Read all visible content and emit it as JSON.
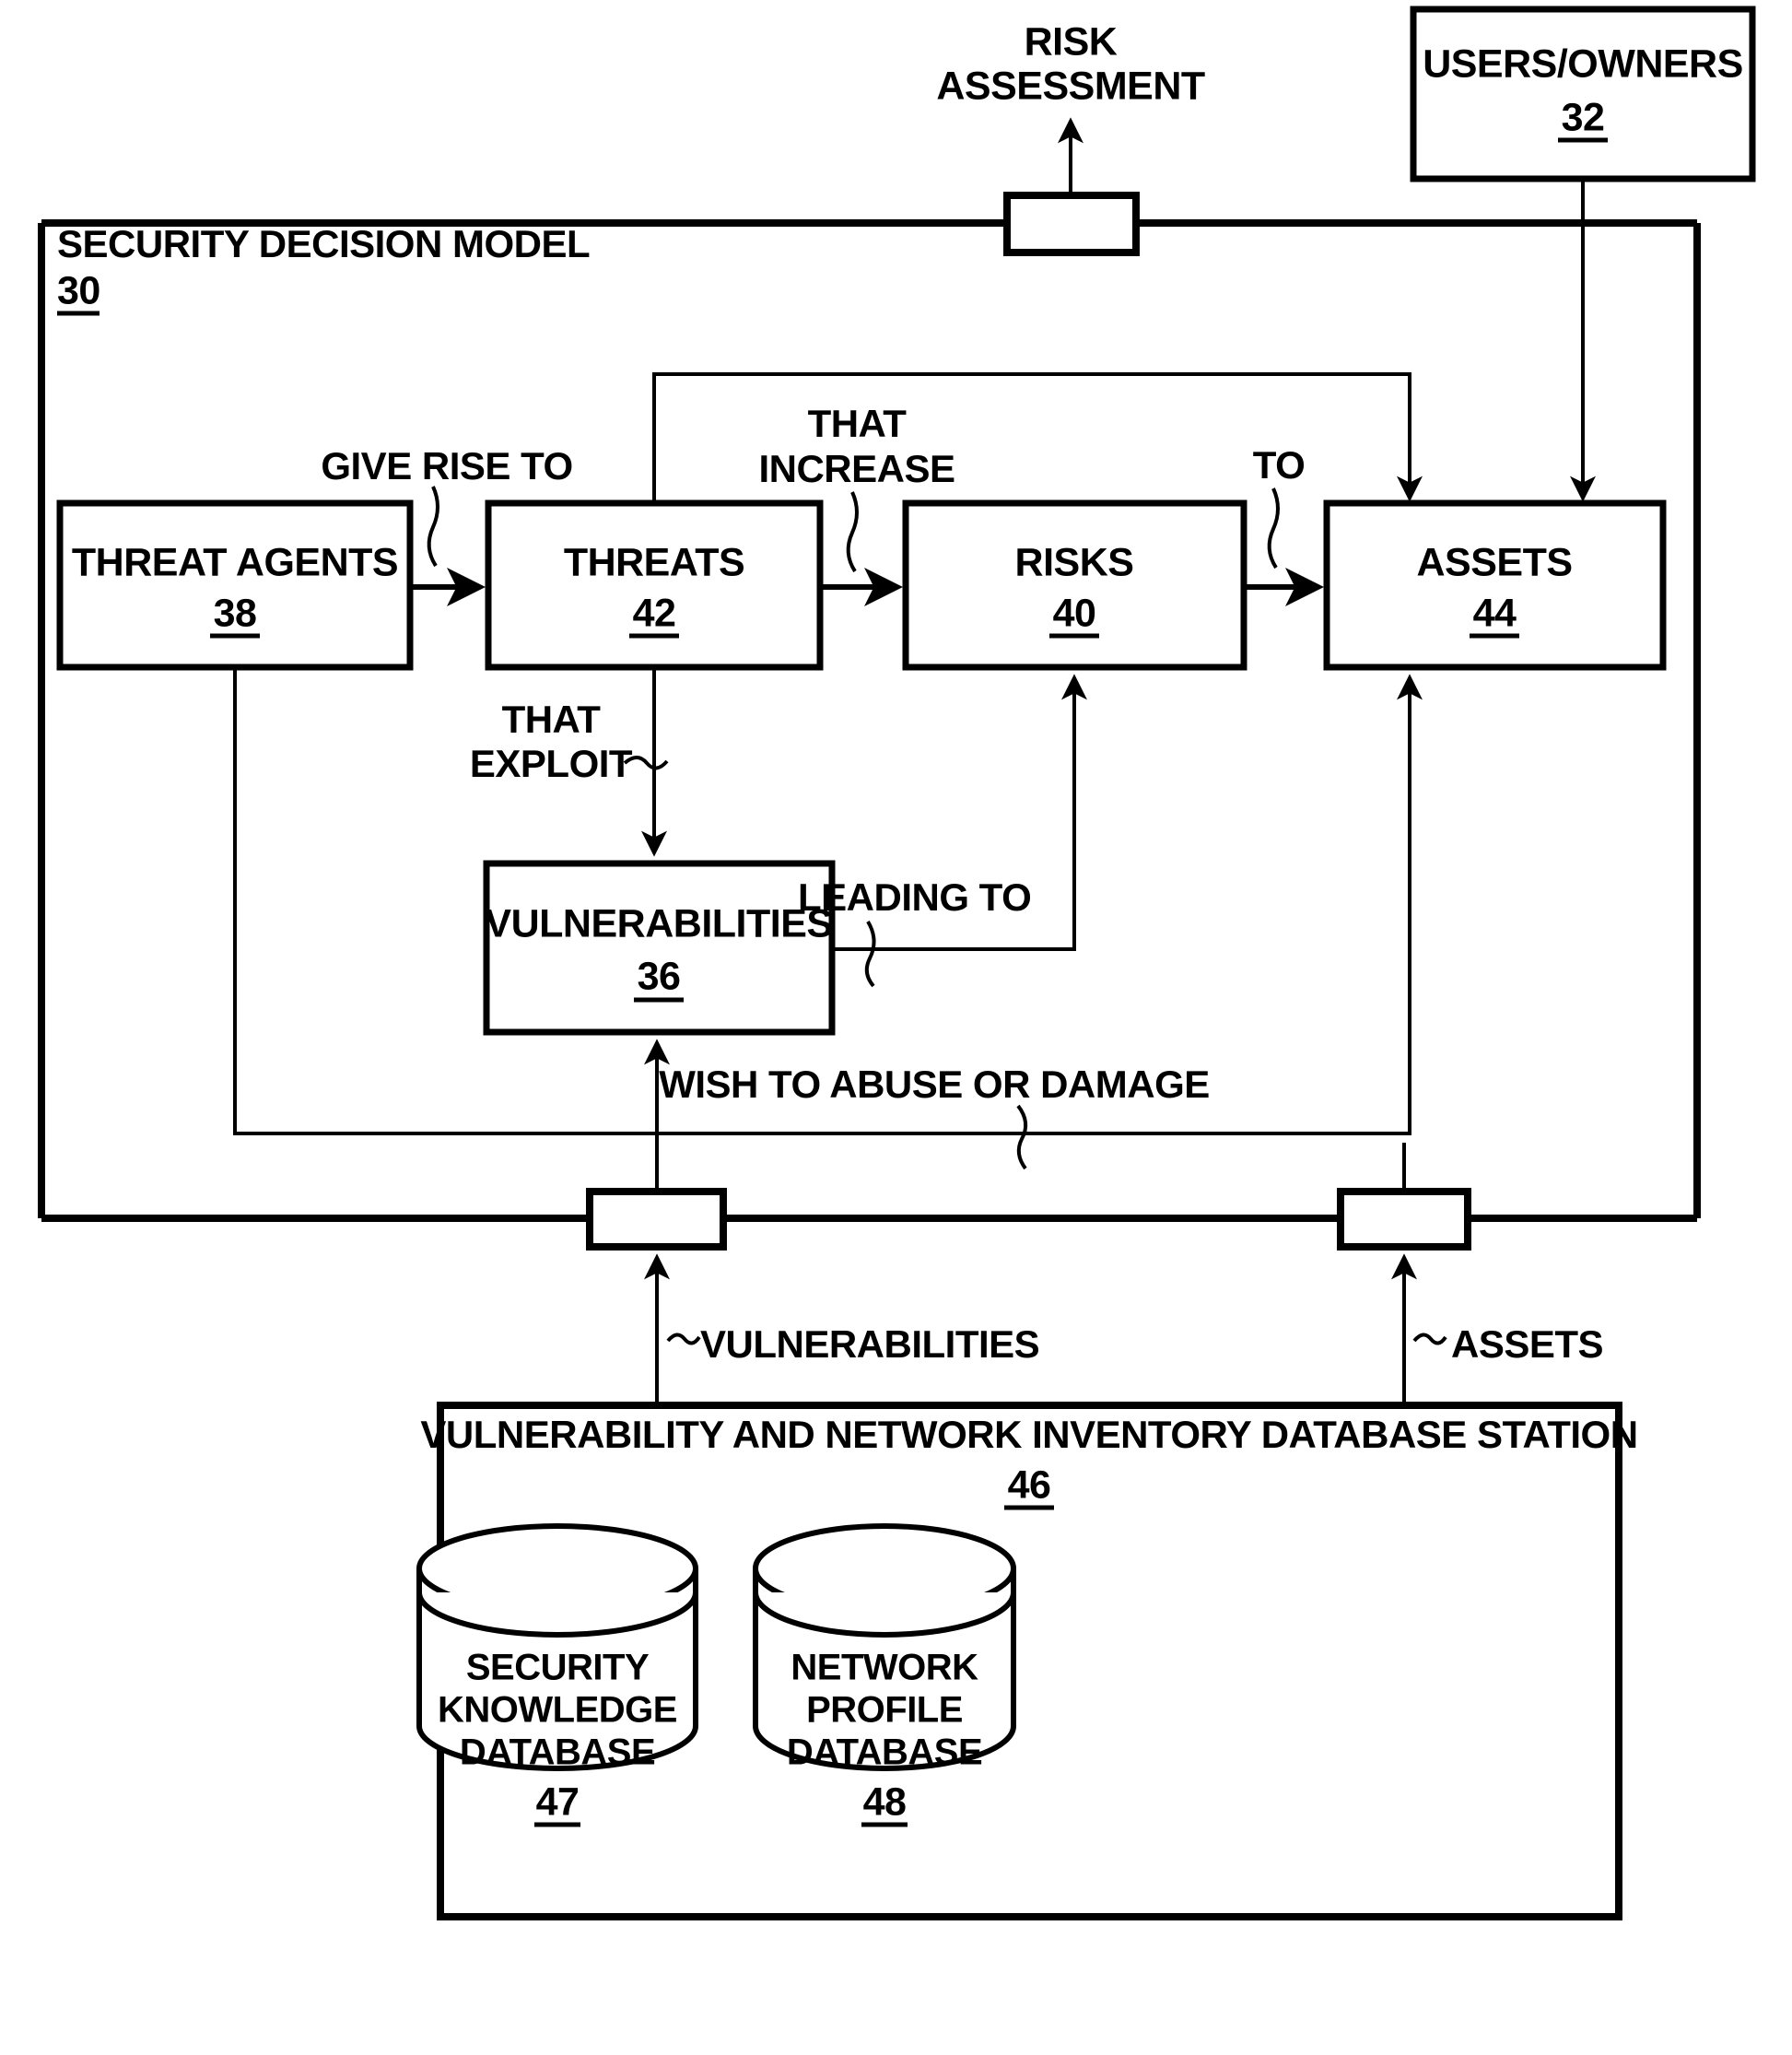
{
  "diagram": {
    "title_note": "RISK ASSESSMENT",
    "outer_model": {
      "label": "SECURITY DECISION MODEL",
      "ref": "30"
    },
    "users_owners": {
      "label": "USERS/OWNERS",
      "ref": "32"
    },
    "boxes": [
      {
        "id": "threat_agents",
        "label": "THREAT AGENTS",
        "ref": "38"
      },
      {
        "id": "threats",
        "label": "THREATS",
        "ref": "42"
      },
      {
        "id": "risks",
        "label": "RISKS",
        "ref": "40"
      },
      {
        "id": "assets",
        "label": "ASSETS",
        "ref": "44"
      },
      {
        "id": "vulnerabilities",
        "label": "VULNERABILITIES",
        "ref": "36"
      }
    ],
    "edge_labels": [
      {
        "id": "give_rise_to",
        "text": "GIVE RISE TO"
      },
      {
        "id": "that_increase_l1",
        "text": "THAT"
      },
      {
        "id": "that_increase_l2",
        "text": "INCREASE"
      },
      {
        "id": "to",
        "text": "TO"
      },
      {
        "id": "that_exploit_l1",
        "text": "THAT"
      },
      {
        "id": "that_exploit_l2",
        "text": "EXPLOIT"
      },
      {
        "id": "leading_to",
        "text": "LEADING TO"
      },
      {
        "id": "wish_to_abuse",
        "text": "WISH TO ABUSE OR DAMAGE"
      },
      {
        "id": "feed_vulnerabilities",
        "text": "VULNERABILITIES"
      },
      {
        "id": "feed_assets",
        "text": "ASSETS"
      }
    ],
    "risk_assessment_label": {
      "line1": "RISK",
      "line2": "ASSESSMENT"
    },
    "database_station": {
      "label": "VULNERABILITY AND NETWORK INVENTORY DATABASE STATION",
      "ref": "46",
      "cylinders": [
        {
          "id": "security_knowledge_db",
          "line1": "SECURITY",
          "line2": "KNOWLEDGE",
          "line3": "DATABASE",
          "ref": "47"
        },
        {
          "id": "network_profile_db",
          "line1": "NETWORK",
          "line2": "PROFILE",
          "line3": "DATABASE",
          "ref": "48"
        }
      ]
    },
    "colors": {
      "ink": "#000000",
      "paper": "#ffffff"
    }
  }
}
